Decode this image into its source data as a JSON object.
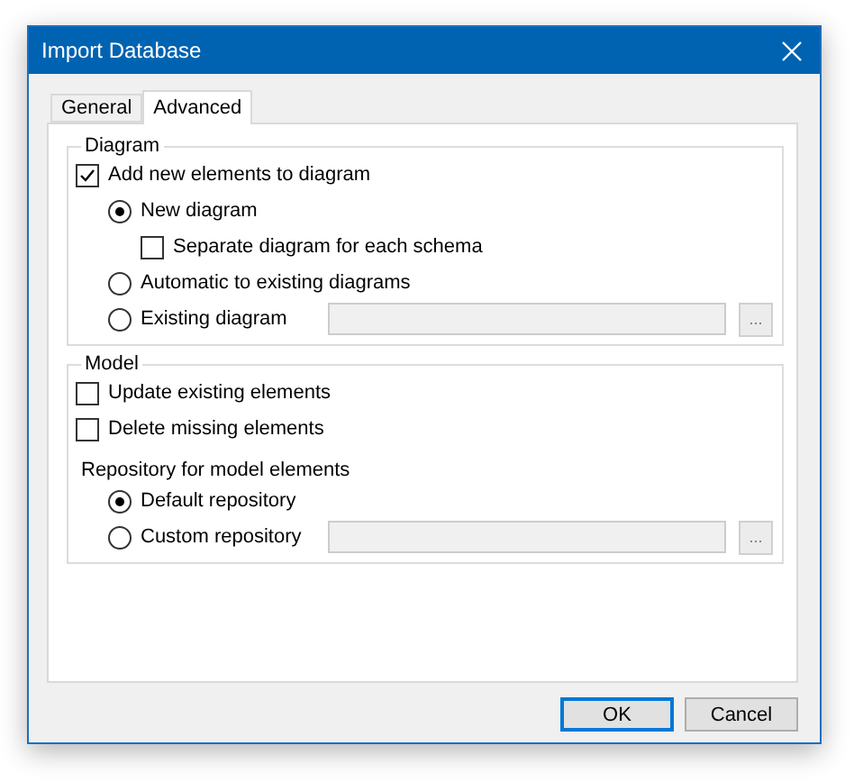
{
  "window": {
    "title": "Import Database"
  },
  "tabs": [
    {
      "label": "General",
      "selected": false
    },
    {
      "label": "Advanced",
      "selected": true
    }
  ],
  "groups": [
    {
      "title": "Diagram",
      "items": [
        {
          "kind": "checkbox",
          "label": "Add new elements to diagram",
          "checked": true,
          "children": [
            {
              "kind": "radio",
              "label": "New diagram",
              "selected": true,
              "children": [
                {
                  "kind": "checkbox",
                  "label": "Separate diagram for each schema",
                  "checked": false
                }
              ]
            },
            {
              "kind": "radio",
              "label": "Automatic to existing diagrams",
              "selected": false
            },
            {
              "kind": "radio",
              "label": "Existing diagram",
              "selected": false,
              "field": {
                "disabled": true
              },
              "browse": "..."
            }
          ]
        }
      ]
    },
    {
      "title": "Model",
      "items": [
        {
          "kind": "checkbox",
          "label": "Update existing elements",
          "checked": false
        },
        {
          "kind": "checkbox",
          "label": "Delete missing elements",
          "checked": false
        },
        {
          "kind": "heading",
          "label": "Repository for model elements",
          "children": [
            {
              "kind": "radio",
              "label": "Default repository",
              "selected": true
            },
            {
              "kind": "radio",
              "label": "Custom repository",
              "selected": false,
              "field": {
                "disabled": true
              },
              "browse": "..."
            }
          ]
        }
      ]
    }
  ],
  "buttons": [
    {
      "label": "OK",
      "default": true
    },
    {
      "label": "Cancel",
      "default": false
    }
  ]
}
